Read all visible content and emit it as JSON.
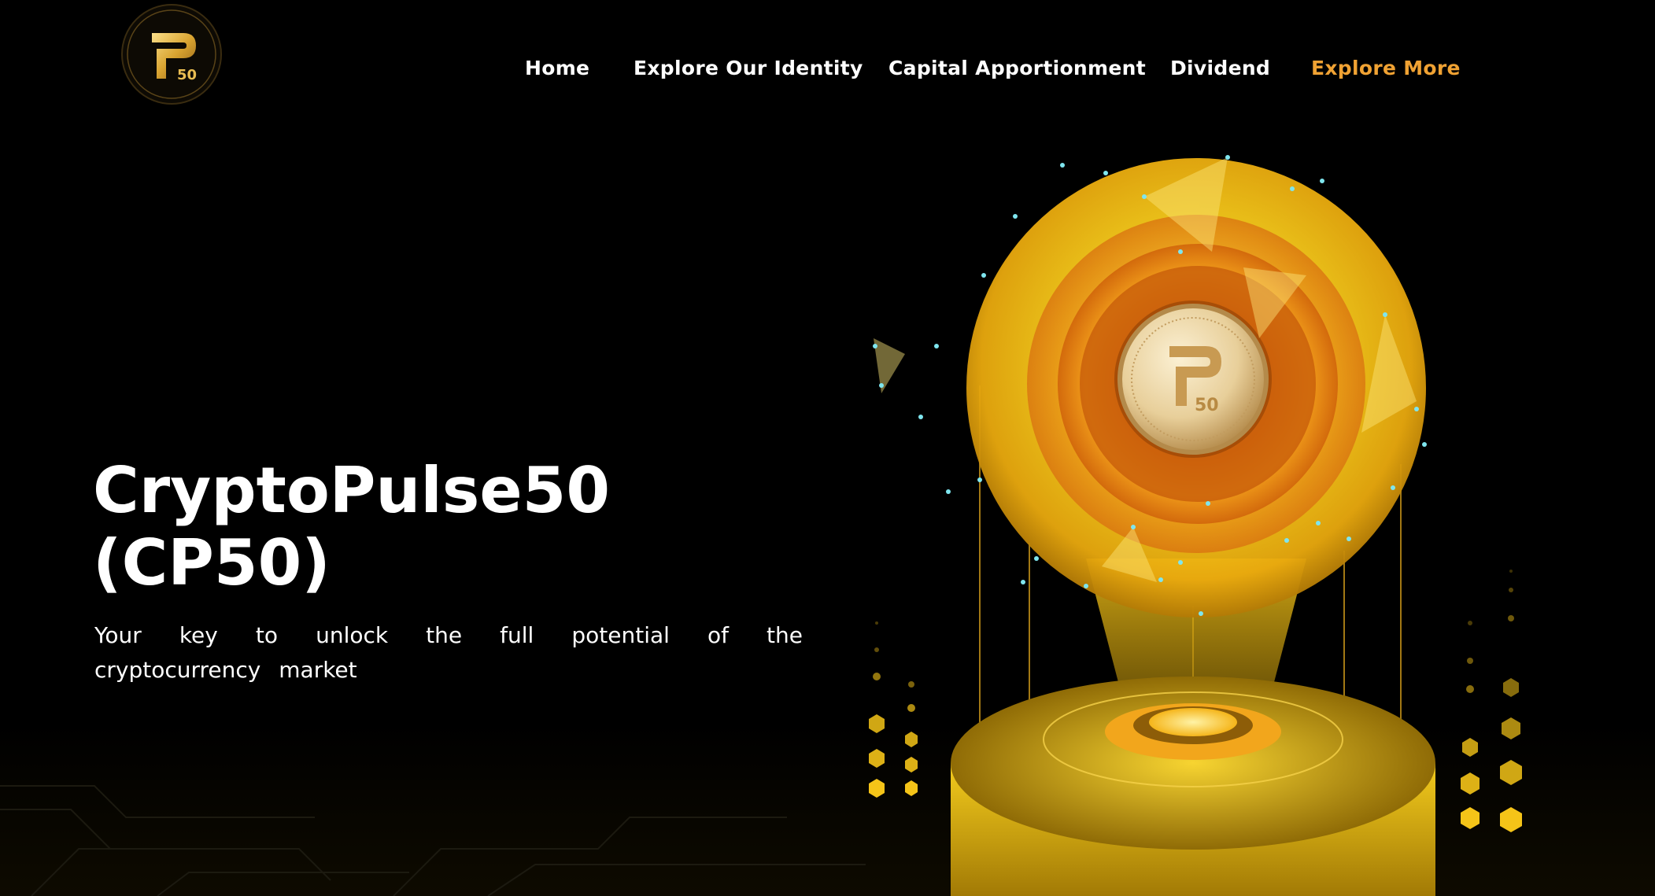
{
  "brand": {
    "logo_monogram": "P",
    "logo_number": "50",
    "accent_color": "#f0a233",
    "gold_color": "#f5c418"
  },
  "nav": {
    "items": [
      {
        "label": "Home",
        "active": false
      },
      {
        "label": "Explore Our Identity",
        "active": false
      },
      {
        "label": "Capital Apportionment",
        "active": false
      },
      {
        "label": "Dividend",
        "active": false
      },
      {
        "label": "Explore More",
        "active": true
      }
    ]
  },
  "hero": {
    "title_line1": "CryptoPulse50",
    "title_line2": "(CP50)",
    "subtitle": "Your key to unlock the full potential of the cryptocurrency market"
  },
  "illustration": {
    "coin_monogram": "P",
    "coin_number": "50"
  }
}
